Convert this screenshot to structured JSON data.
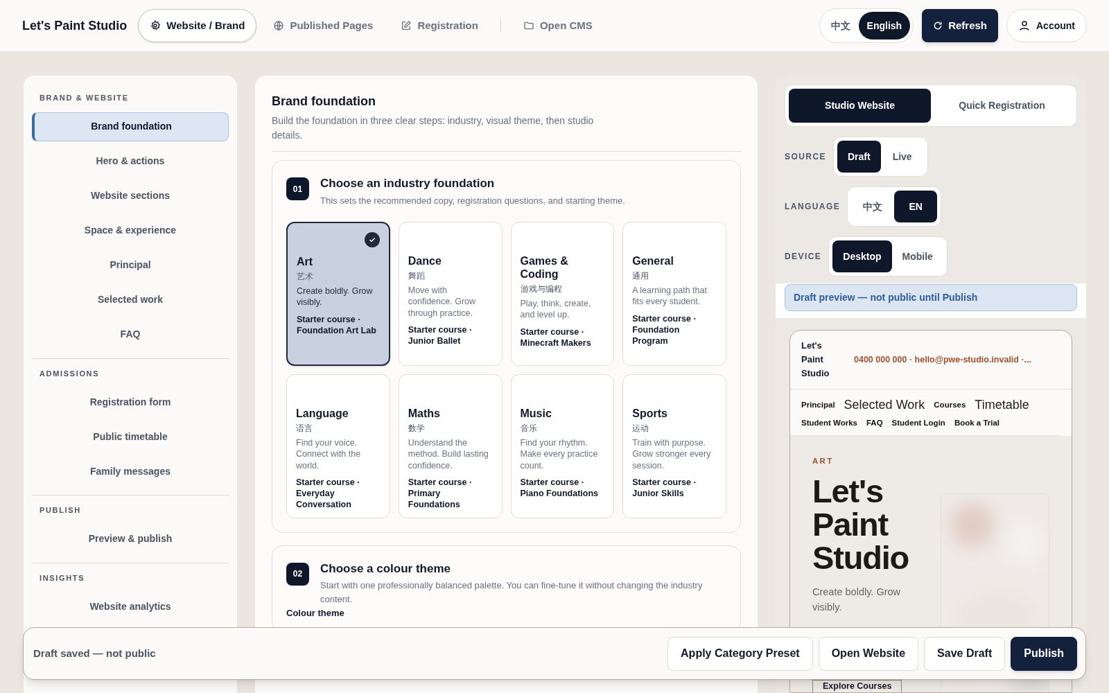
{
  "header": {
    "logo": "Let's Paint Studio",
    "nav": [
      {
        "label": "Website / Brand",
        "selected": true
      },
      {
        "label": "Published Pages",
        "selected": false
      },
      {
        "label": "Registration",
        "selected": false
      },
      {
        "label": "Open CMS",
        "selected": false
      }
    ],
    "languages": [
      {
        "label": "中文",
        "selected": false
      },
      {
        "label": "English",
        "selected": true
      }
    ],
    "refresh": "Refresh",
    "account": "Account"
  },
  "sidebar": {
    "sections": [
      {
        "title": "BRAND & WEBSITE",
        "items": [
          {
            "label": "Brand foundation",
            "selected": true
          },
          {
            "label": "Hero & actions",
            "selected": false
          },
          {
            "label": "Website sections",
            "selected": false
          },
          {
            "label": "Space & experience",
            "selected": false
          },
          {
            "label": "Principal",
            "selected": false
          },
          {
            "label": "Selected work",
            "selected": false
          },
          {
            "label": "FAQ",
            "selected": false
          }
        ]
      },
      {
        "title": "ADMISSIONS",
        "items": [
          {
            "label": "Registration form",
            "selected": false
          },
          {
            "label": "Public timetable",
            "selected": false
          },
          {
            "label": "Family messages",
            "selected": false
          }
        ]
      },
      {
        "title": "PUBLISH",
        "items": [
          {
            "label": "Preview & publish",
            "selected": false
          }
        ]
      },
      {
        "title": "INSIGHTS",
        "items": [
          {
            "label": "Website analytics",
            "selected": false
          }
        ]
      }
    ]
  },
  "editor": {
    "title": "Brand foundation",
    "description": "Build the foundation in three clear steps: industry, visual theme, then studio details.",
    "step_1": {
      "number": "01",
      "title": "Choose an industry foundation",
      "description": "This sets the recommended copy, registration questions, and starting theme.",
      "industries": [
        {
          "name": "Art",
          "chinese": "艺术",
          "tagline": "Create boldly. Grow visibly.",
          "course": "Starter course · Foundation Art Lab",
          "selected": true
        },
        {
          "name": "Dance",
          "chinese": "舞蹈",
          "tagline": "Move with confidence. Grow through practice.",
          "course": "Starter course · Junior Ballet",
          "selected": false
        },
        {
          "name": "Games & Coding",
          "chinese": "游戏与编程",
          "tagline": "Play, think, create, and level up.",
          "course": "Starter course · Minecraft Makers",
          "selected": false
        },
        {
          "name": "General",
          "chinese": "通用",
          "tagline": "A learning path that fits every student.",
          "course": "Starter course · Foundation Program",
          "selected": false
        },
        {
          "name": "Language",
          "chinese": "语言",
          "tagline": "Find your voice. Connect with the world.",
          "course": "Starter course · Everyday Conversation",
          "selected": false
        },
        {
          "name": "Maths",
          "chinese": "数学",
          "tagline": "Understand the method. Build lasting confidence.",
          "course": "Starter course · Primary Foundations",
          "selected": false
        },
        {
          "name": "Music",
          "chinese": "音乐",
          "tagline": "Find your rhythm. Make every practice count.",
          "course": "Starter course · Piano Foundations",
          "selected": false
        },
        {
          "name": "Sports",
          "chinese": "运动",
          "tagline": "Train with purpose. Grow stronger every session.",
          "course": "Starter course · Junior Skills",
          "selected": false
        }
      ]
    },
    "step_2": {
      "number": "02",
      "title": "Choose a colour theme",
      "description": "Start with one professionally balanced palette. You can fine-tune it without changing the industry content.",
      "field_label": "Colour theme"
    }
  },
  "preview_panel": {
    "modes": [
      {
        "label": "Studio Website",
        "selected": true
      },
      {
        "label": "Quick Registration",
        "selected": false
      }
    ],
    "controls": [
      {
        "label": "SOURCE",
        "options": [
          {
            "label": "Draft",
            "selected": true
          },
          {
            "label": "Live",
            "selected": false
          }
        ]
      },
      {
        "label": "LANGUAGE",
        "options": [
          {
            "label": "中文",
            "selected": false
          },
          {
            "label": "EN",
            "selected": true
          }
        ]
      },
      {
        "label": "DEVICE",
        "options": [
          {
            "label": "Desktop",
            "selected": true
          },
          {
            "label": "Mobile",
            "selected": false
          }
        ]
      }
    ],
    "notice": "Draft preview — not public until Publish",
    "site": {
      "name": "Let's Paint Studio",
      "contact": "0400 000 000 · hello@pwe-studio.invalid ·...",
      "nav": [
        {
          "label": "Principal",
          "kind": "bold"
        },
        {
          "label": "Selected Work",
          "kind": "plain"
        },
        {
          "label": "Courses",
          "kind": "bold"
        },
        {
          "label": "Timetable",
          "kind": "plain"
        },
        {
          "label": "Student Works",
          "kind": "bold"
        },
        {
          "label": "FAQ",
          "kind": "bold"
        },
        {
          "label": "Student Login",
          "kind": "bold"
        },
        {
          "label": "Book a Trial",
          "kind": "bold"
        }
      ],
      "eyebrow": "ART",
      "headline": "Let's Paint Studio",
      "tagline": "Create boldly. Grow visibly.",
      "button": "Explore Courses"
    }
  },
  "action_bar": {
    "status": "Draft saved — not public",
    "buttons": [
      {
        "label": "Apply Category Preset",
        "kind": "secondary"
      },
      {
        "label": "Open Website",
        "kind": "secondary"
      },
      {
        "label": "Save Draft",
        "kind": "secondary"
      },
      {
        "label": "Publish",
        "kind": "primary"
      }
    ]
  }
}
